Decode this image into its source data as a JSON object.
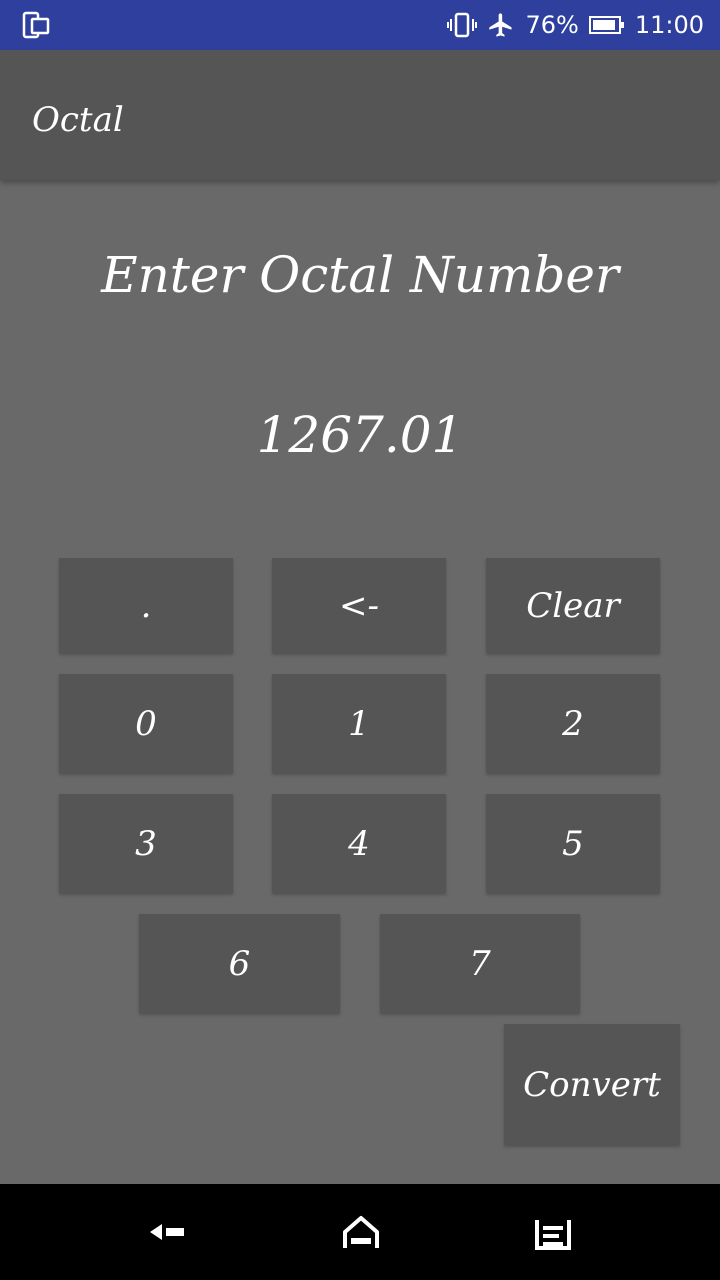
{
  "status_bar": {
    "battery_percent": "76%",
    "time": "11:00",
    "icons": [
      "screen-mirror-icon",
      "vibrate-icon",
      "airplane-mode-icon",
      "battery-icon"
    ]
  },
  "app_bar": {
    "title": "Octal"
  },
  "main": {
    "prompt": "Enter Octal Number",
    "value": "1267.01"
  },
  "keypad": {
    "dot": ".",
    "backspace": "<-",
    "clear": "Clear",
    "k0": "0",
    "k1": "1",
    "k2": "2",
    "k3": "3",
    "k4": "4",
    "k5": "5",
    "k6": "6",
    "k7": "7",
    "convert": "Convert"
  },
  "nav_bar": {
    "icons": [
      "back-icon",
      "home-icon",
      "recents-icon"
    ]
  },
  "colors": {
    "status_bar": "#2f3f9e",
    "app_bar": "#555555",
    "background": "#696969",
    "key": "#555555",
    "nav_bar": "#000000"
  }
}
